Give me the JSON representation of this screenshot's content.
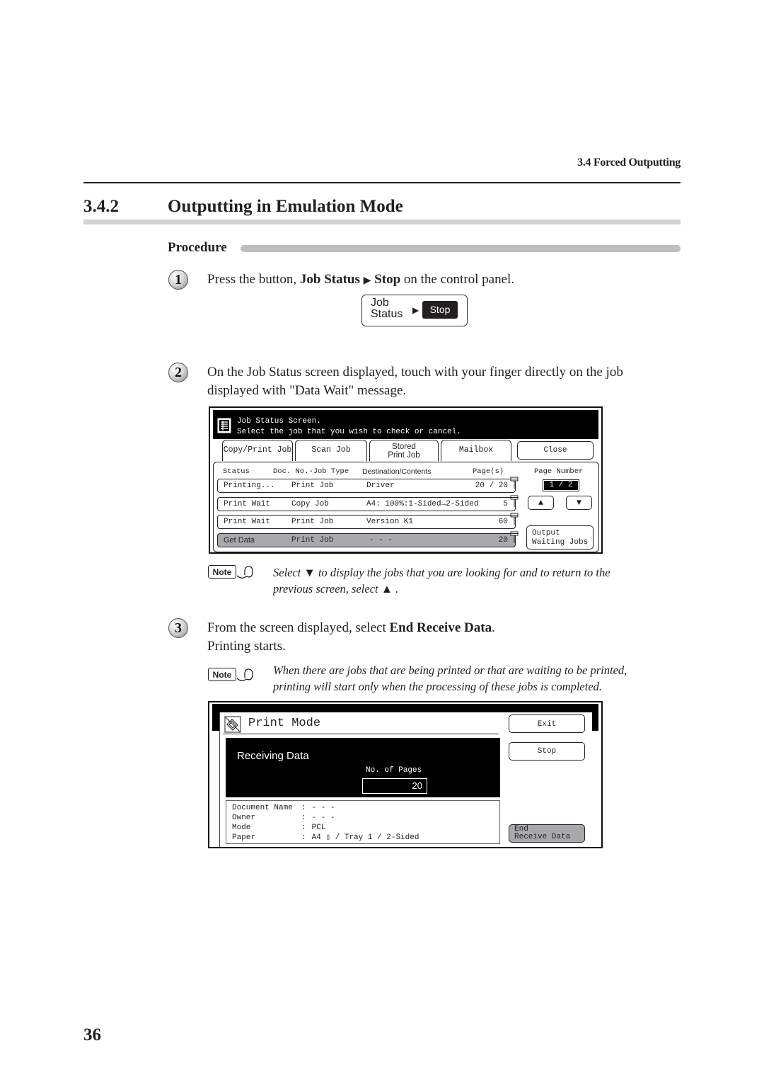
{
  "running_head": "3.4 Forced Outputting",
  "section": {
    "number": "3.4.2",
    "title": "Outputting in Emulation Mode"
  },
  "procedure_label": "Procedure",
  "steps": [
    {
      "num": "1",
      "pre": "Press the button, ",
      "bold1": "Job Status",
      "arrow": "▶",
      "bold2": "Stop",
      "post": " on the control panel."
    },
    {
      "num": "2",
      "line1": "On the Job Status screen displayed, touch with your finger directly on the job",
      "line2": "displayed with \"Data Wait\" message."
    },
    {
      "num": "3",
      "pre": "From the screen displayed, select ",
      "bold": "End Receive Data",
      "post": ".",
      "line2": "Printing starts."
    }
  ],
  "control_panel": {
    "label_line1": "Job",
    "label_line2": "Status",
    "arrow": "▶",
    "stop": "Stop"
  },
  "job_status_screen": {
    "header_line1": "Job Status Screen.",
    "header_line2": "Select the job that you wish to check or cancel.",
    "tabs": [
      {
        "label": "Copy/Print Job",
        "active": true
      },
      {
        "label": "Scan Job"
      },
      {
        "label_line1": "Stored",
        "label_line2": "Print Job"
      },
      {
        "label": "Mailbox"
      }
    ],
    "close_button": "Close",
    "columns": {
      "status": "Status",
      "doc_no": "Doc. No.-Job Type",
      "dest": "Destination/Contents",
      "pages": "Page(s)"
    },
    "page_number_label": "Page Number",
    "page_number_value": "1 / 2",
    "up_arrow": "▲",
    "down_arrow": "▼",
    "output_waiting_line1": "Output",
    "output_waiting_line2": "Waiting Jobs",
    "rows": [
      {
        "status": "Printing...",
        "type": "Print Job",
        "dest": "Driver",
        "pages": "20 / 20"
      },
      {
        "status": "Print Wait",
        "type": "Copy Job",
        "dest": "A4: 100%:1-Sided→2-Sided",
        "pages": "5"
      },
      {
        "status": "Print Wait",
        "type": "Print Job",
        "dest": "Version K1",
        "pages": "60"
      },
      {
        "status": "Get Data",
        "type": "Print Job",
        "dest": "- - -",
        "pages": "20",
        "selected": true
      }
    ]
  },
  "note1": {
    "badge": "Note",
    "line1": "Select ▼ to display the jobs that you are looking for and to return to the",
    "line2": "previous screen, select ▲ ."
  },
  "note2": {
    "badge": "Note",
    "line1": "When there are jobs that are being printed or that are waiting to be printed,",
    "line2": "printing will start only when the processing of these jobs is completed."
  },
  "print_mode_screen": {
    "title": "Print Mode",
    "exit_button": "Exit",
    "stop_button": "Stop",
    "status": "Receiving Data",
    "pages_label": "No. of Pages",
    "pages_value": "20",
    "info": [
      {
        "label": "Document Name",
        "value": "- - -"
      },
      {
        "label": "Owner",
        "value": "- - -"
      },
      {
        "label": "Mode",
        "value": "PCL"
      },
      {
        "label": "Paper",
        "value": "A4 ▯ /  Tray 1  /  2-Sided"
      }
    ],
    "end_receive_line1": "End",
    "end_receive_line2": "Receive Data"
  },
  "page_number": "36"
}
